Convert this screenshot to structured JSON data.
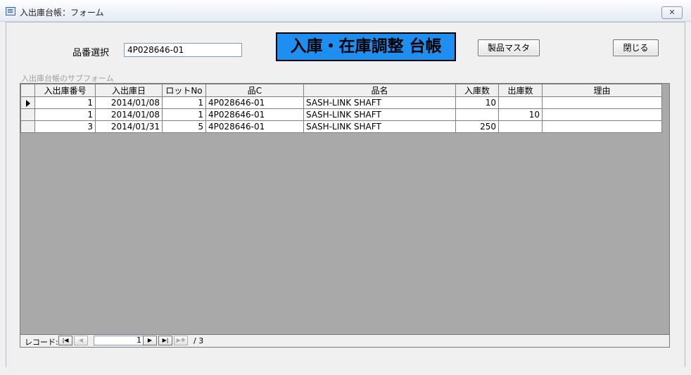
{
  "window": {
    "title": "入出庫台帳：フォーム",
    "close_glyph": "✕"
  },
  "form": {
    "hinban_label": "品番選択",
    "hinban_value": "4P028646-01",
    "big_title": "入庫・在庫調整 台帳",
    "master_button": "製品マスタ",
    "close_button": "閉じる",
    "subform_label": "入出庫台帳のサブフォーム"
  },
  "datasheet": {
    "columns": [
      "入出庫番号",
      "入出庫日",
      "ロットNo",
      "品C",
      "品名",
      "入庫数",
      "出庫数",
      "理由"
    ],
    "rows": [
      [
        "1",
        "2014/01/08",
        "1",
        "4P028646-01",
        "SASH-LINK  SHAFT",
        "10",
        "",
        ""
      ],
      [
        "1",
        "2014/01/08",
        "1",
        "4P028646-01",
        "SASH-LINK  SHAFT",
        "",
        "10",
        ""
      ],
      [
        "3",
        "2014/01/31",
        "5",
        "4P028646-01",
        "SASH-LINK  SHAFT",
        "250",
        "",
        ""
      ]
    ],
    "current_row_index": 0
  },
  "navigation": {
    "label": "レコード:",
    "current": "1",
    "total": "/ 3",
    "first_glyph": "|◀",
    "prev_glyph": "◀",
    "next_glyph": "▶",
    "last_glyph": "▶|",
    "new_glyph": "▶✱"
  },
  "colors": {
    "title_background": "#1e8ff0",
    "datasheet_background": "#a9a9a9"
  }
}
